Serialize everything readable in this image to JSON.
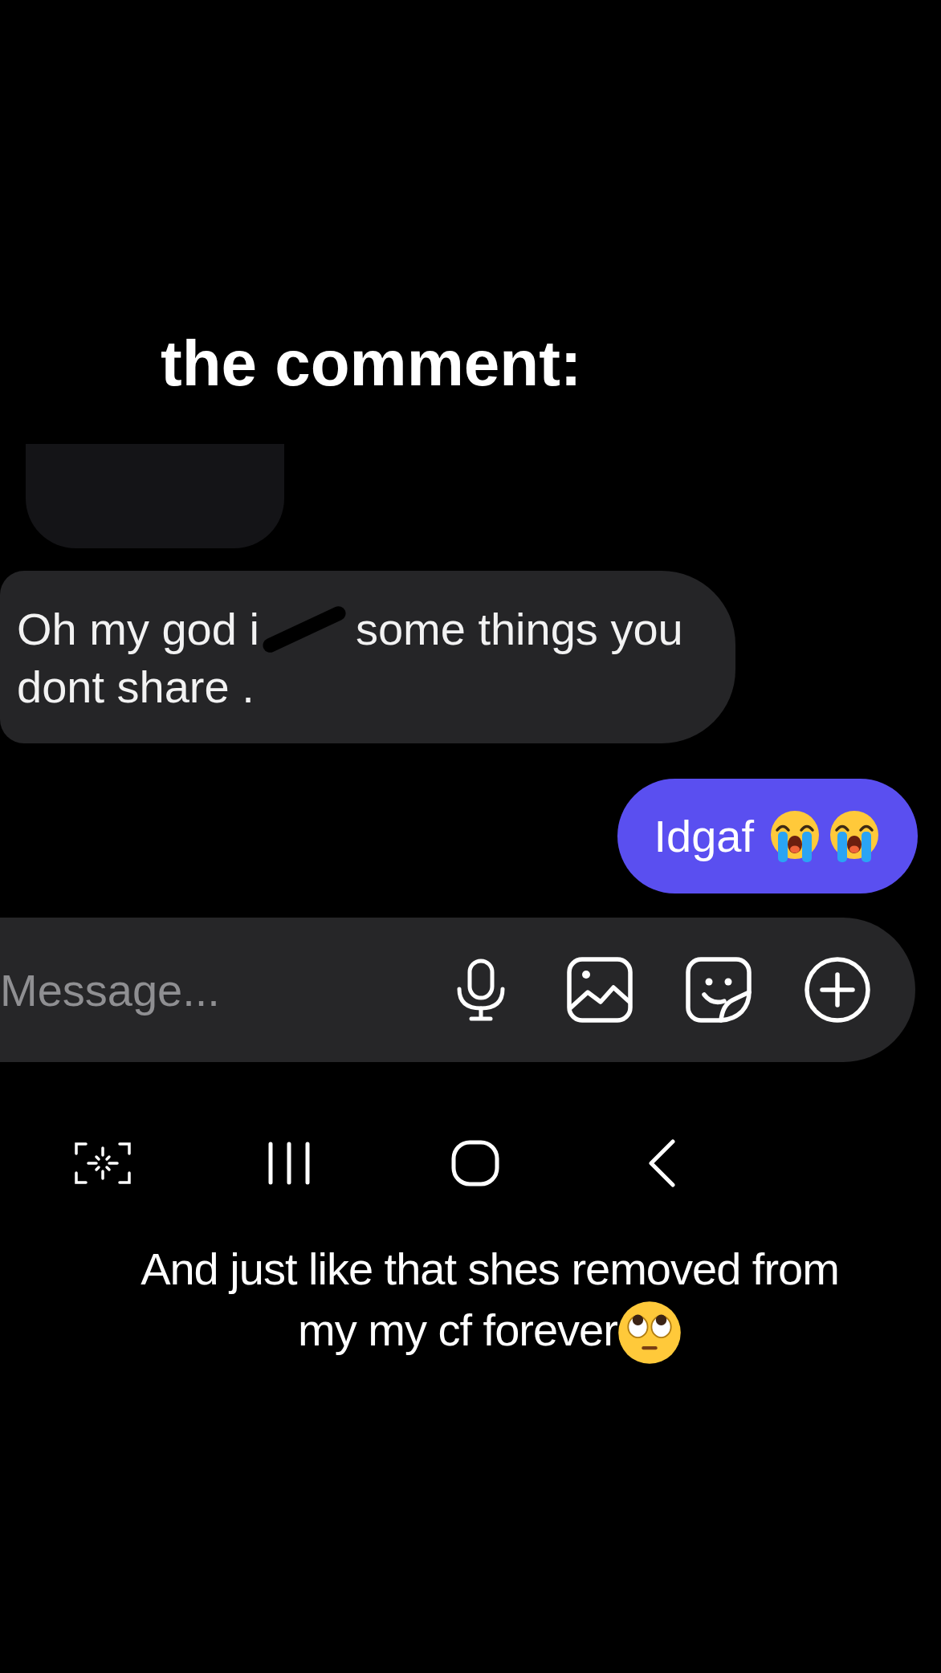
{
  "overlay_title": "the comment:",
  "received_message": {
    "lines": [
      [
        {
          "kind": "text",
          "text": "Oh my god i"
        },
        {
          "kind": "redaction"
        },
        {
          "kind": "text",
          "text": "some things you"
        }
      ],
      [
        {
          "kind": "text",
          "text": "dont share ."
        }
      ]
    ]
  },
  "sent_message": {
    "text": "Idgaf"
  },
  "composer": {
    "placeholder": "Message..."
  },
  "caption": {
    "lines": [
      "And just like that shes removed from",
      "my my cf forever"
    ]
  }
}
